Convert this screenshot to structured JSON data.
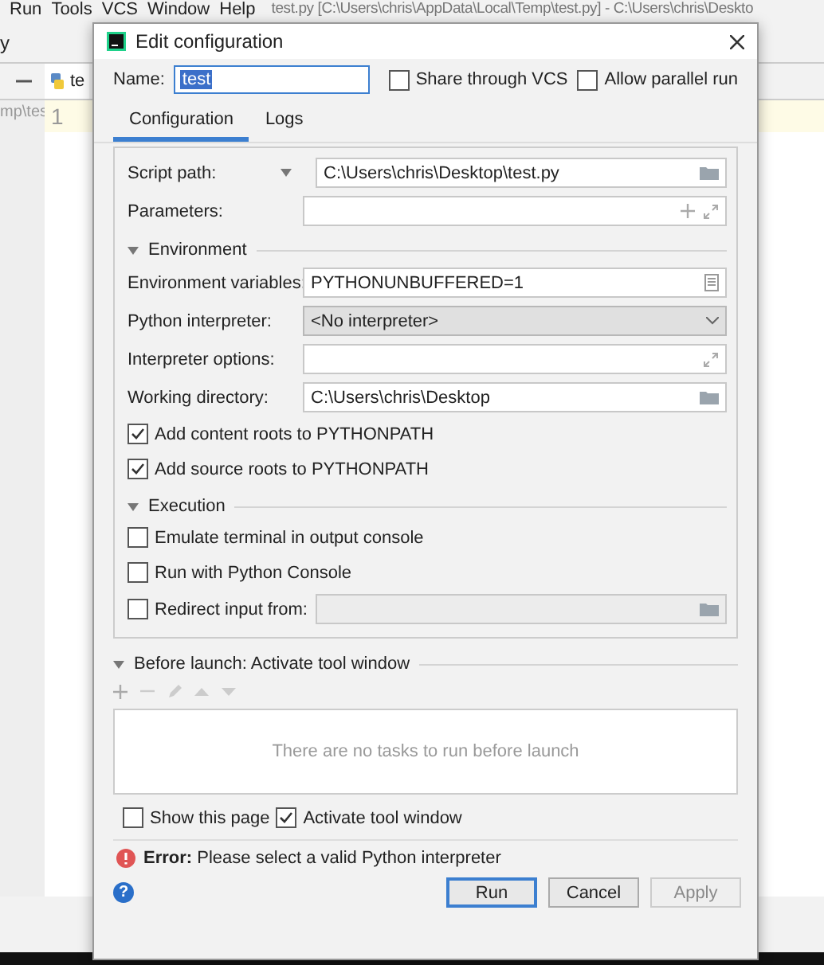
{
  "ide": {
    "menu": [
      "Run",
      "Tools",
      "VCS",
      "Window",
      "Help"
    ],
    "title": "test.py [C:\\Users\\chris\\AppData\\Local\\Temp\\test.py] - C:\\Users\\chris\\Deskto",
    "toolbar_text": "y",
    "tab": "te",
    "path": "mp\\tes",
    "line_number": "1"
  },
  "dialog": {
    "title": "Edit configuration",
    "name_label": "Name:",
    "name_value": "test",
    "options": [
      {
        "label": "Share through VCS",
        "checked": false
      },
      {
        "label": "Allow parallel run",
        "checked": false
      }
    ],
    "tabs": [
      {
        "label": "Configuration",
        "selected": true
      },
      {
        "label": "Logs",
        "selected": false
      }
    ],
    "script_path": {
      "label": "Script path:",
      "value": "C:\\Users\\chris\\Desktop\\test.py"
    },
    "parameters": {
      "label": "Parameters:"
    },
    "environment": {
      "title": "Environment",
      "expanded": true,
      "fields": [
        {
          "kind": "listfield",
          "label": "Environment variables:",
          "value": "PYTHONUNBUFFERED=1"
        },
        {
          "kind": "select",
          "label": "Python interpreter:",
          "value": "<No interpreter>"
        },
        {
          "kind": "expandfield",
          "label": "Interpreter options:"
        },
        {
          "kind": "browsefield",
          "label": "Working directory:",
          "value": "C:\\Users\\chris\\Desktop"
        }
      ],
      "checks": [
        {
          "label": "Add content roots to PYTHONPATH",
          "checked": true
        },
        {
          "label": "Add source roots to PYTHONPATH",
          "checked": true
        }
      ]
    },
    "execution": {
      "title": "Execution",
      "expanded": true,
      "checks": [
        {
          "label": "Emulate terminal in output console",
          "checked": false
        },
        {
          "label": "Run with Python Console",
          "checked": false
        }
      ],
      "redirect": {
        "label": "Redirect input from:",
        "checked": false,
        "disabled": true
      }
    },
    "before_launch": {
      "title": "Before launch: Activate tool window",
      "expanded": true,
      "empty_text": "There are no tasks to run before launch"
    },
    "launch_options": [
      {
        "label": "Show this page",
        "checked": false
      },
      {
        "label": "Activate tool window",
        "checked": true
      }
    ],
    "error": {
      "prefix": "Error:",
      "message": "Please select a valid Python interpreter"
    },
    "help": "?",
    "buttons": [
      {
        "label": "Run",
        "default": true,
        "disabled": false
      },
      {
        "label": "Cancel",
        "default": false,
        "disabled": false
      },
      {
        "label": "Apply",
        "default": false,
        "disabled": true
      }
    ]
  }
}
